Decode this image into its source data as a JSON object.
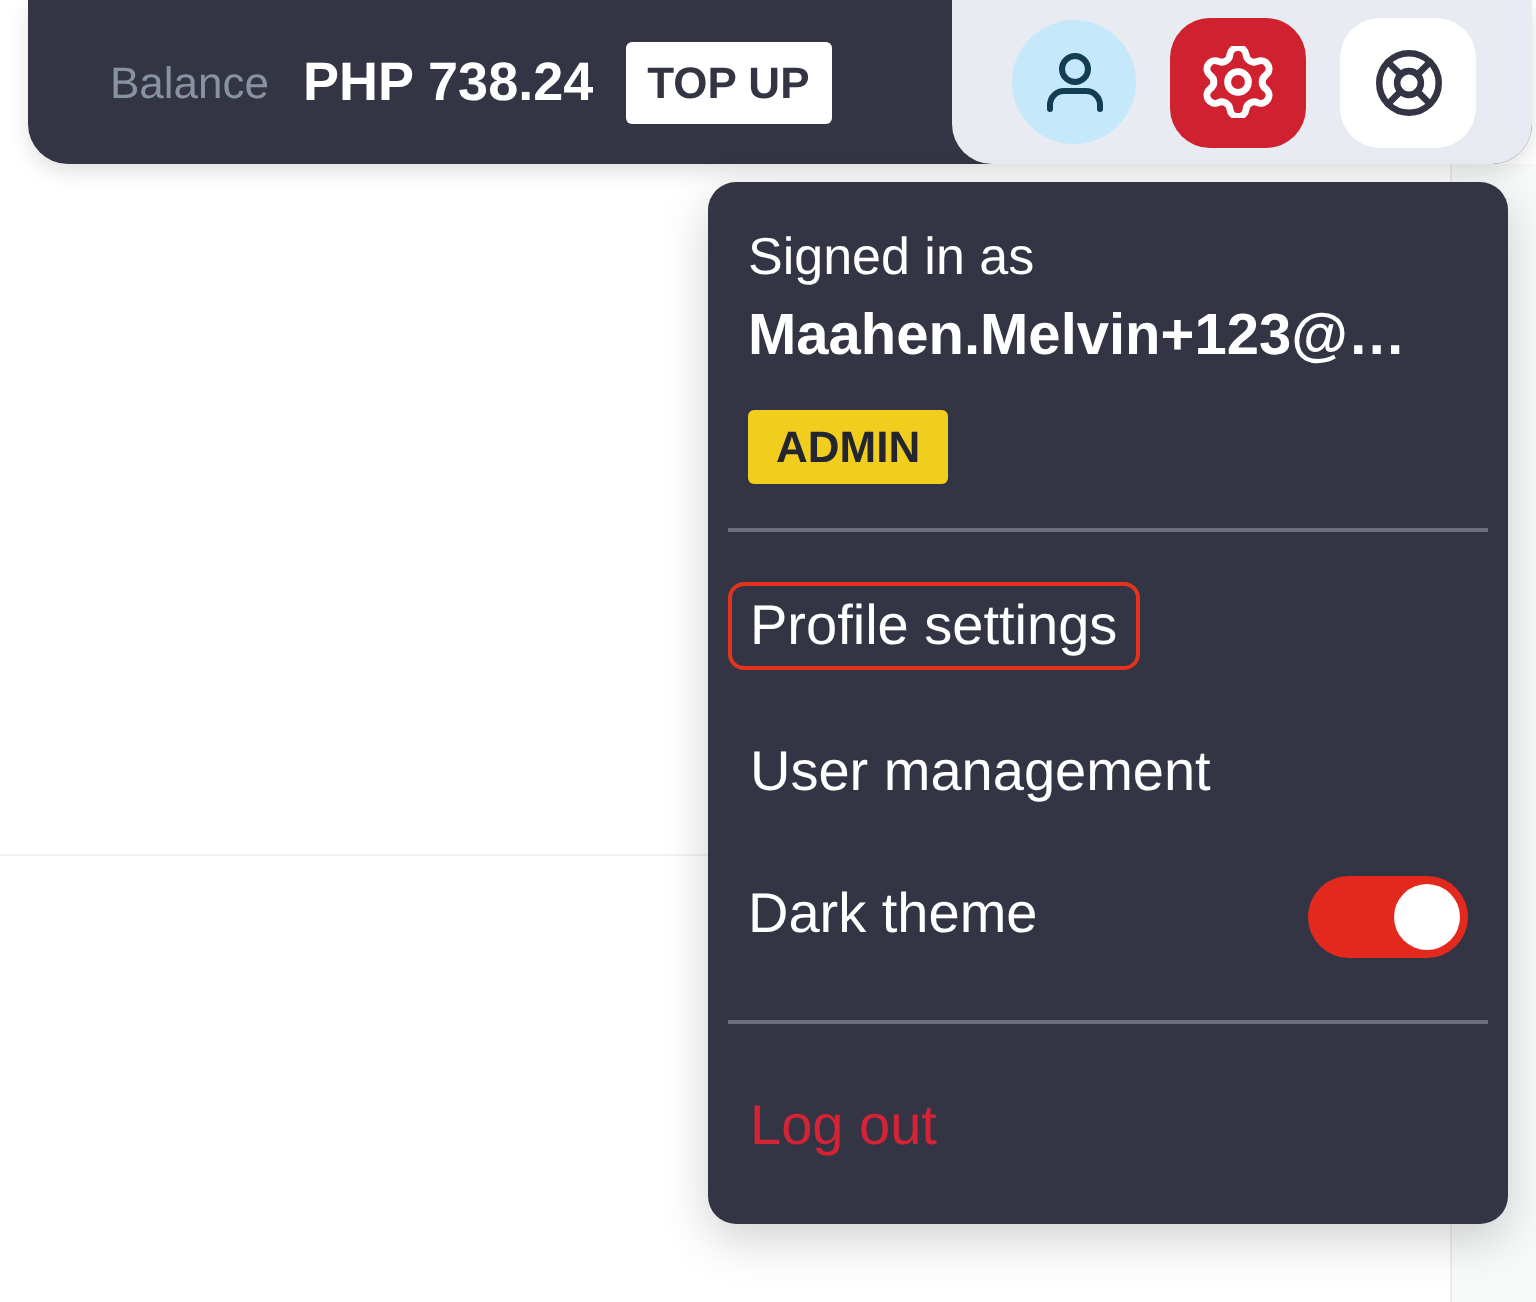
{
  "top_bar": {
    "balance_label": "Balance",
    "balance_amount": "PHP 738.24",
    "top_up_button": "TOP UP"
  },
  "header_buttons": [
    {
      "kind": "profile"
    },
    {
      "kind": "settings"
    },
    {
      "kind": "help"
    }
  ],
  "account_menu": {
    "signed_in_label": "Signed in as",
    "email": "Maahen.Melvin+123@…",
    "role_badge": "ADMIN",
    "items": [
      {
        "kind": "link",
        "label": "Profile settings",
        "focused": true
      },
      {
        "kind": "link",
        "label": "User management",
        "focused": false
      },
      {
        "kind": "toggle",
        "label": "Dark theme",
        "on": true,
        "focused": false
      },
      {
        "kind": "logout",
        "label": "Log out",
        "focused": false
      }
    ]
  }
}
